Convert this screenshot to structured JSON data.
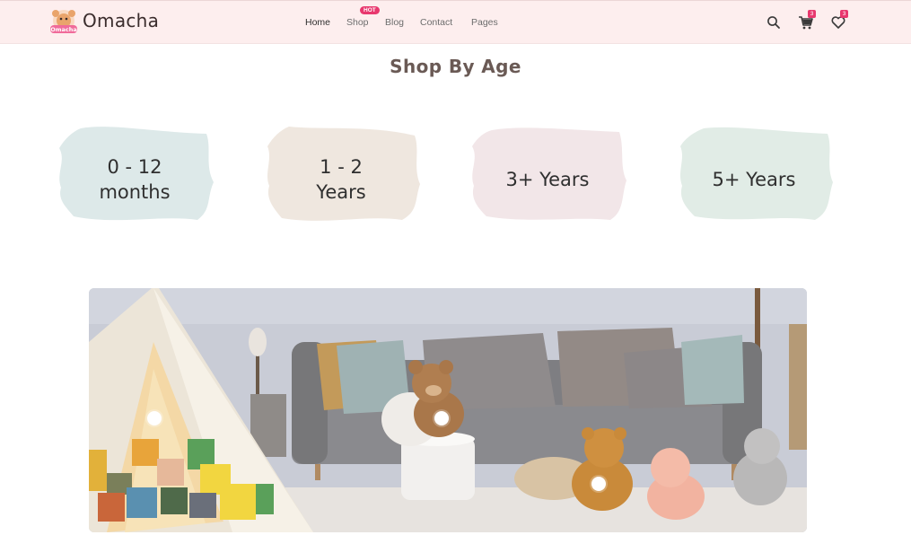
{
  "brand": {
    "name": "Omacha",
    "logo_text": "Omacha"
  },
  "nav": {
    "items": [
      {
        "label": "Home"
      },
      {
        "label": "Shop"
      },
      {
        "label": "Blog"
      },
      {
        "label": "Contact"
      },
      {
        "label": "Pages"
      }
    ],
    "shop_badge": "HOT"
  },
  "header_icons": {
    "search": "search-icon",
    "cart": "cart-icon",
    "wishlist": "heart-icon",
    "cart_count": "3",
    "wishlist_count": "3"
  },
  "section": {
    "title": "Shop By Age"
  },
  "ages": [
    {
      "label": "0 - 12\nmonths",
      "color": "#dde9e9"
    },
    {
      "label": "1 - 2\nYears",
      "color": "#efe7df"
    },
    {
      "label": "3+ Years",
      "color": "#f2e6e8"
    },
    {
      "label": "5+ Years",
      "color": "#e1ece6"
    }
  ],
  "colors": {
    "header_bg": "#fdeeee",
    "badge": "#e8386e",
    "title": "#6a5a55"
  }
}
